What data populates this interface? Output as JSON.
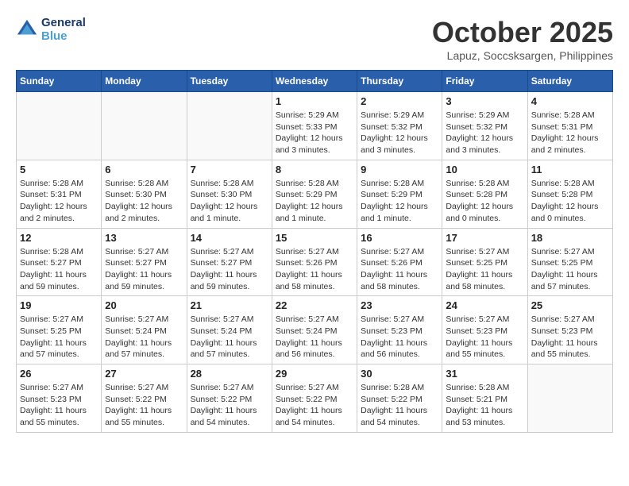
{
  "header": {
    "logo": {
      "line1": "General",
      "line2": "Blue"
    },
    "title": "October 2025",
    "location": "Lapuz, Soccsksargen, Philippines"
  },
  "days_of_week": [
    "Sunday",
    "Monday",
    "Tuesday",
    "Wednesday",
    "Thursday",
    "Friday",
    "Saturday"
  ],
  "weeks": [
    [
      {
        "day": "",
        "info": ""
      },
      {
        "day": "",
        "info": ""
      },
      {
        "day": "",
        "info": ""
      },
      {
        "day": "1",
        "info": "Sunrise: 5:29 AM\nSunset: 5:33 PM\nDaylight: 12 hours and 3 minutes."
      },
      {
        "day": "2",
        "info": "Sunrise: 5:29 AM\nSunset: 5:32 PM\nDaylight: 12 hours and 3 minutes."
      },
      {
        "day": "3",
        "info": "Sunrise: 5:29 AM\nSunset: 5:32 PM\nDaylight: 12 hours and 3 minutes."
      },
      {
        "day": "4",
        "info": "Sunrise: 5:28 AM\nSunset: 5:31 PM\nDaylight: 12 hours and 2 minutes."
      }
    ],
    [
      {
        "day": "5",
        "info": "Sunrise: 5:28 AM\nSunset: 5:31 PM\nDaylight: 12 hours and 2 minutes."
      },
      {
        "day": "6",
        "info": "Sunrise: 5:28 AM\nSunset: 5:30 PM\nDaylight: 12 hours and 2 minutes."
      },
      {
        "day": "7",
        "info": "Sunrise: 5:28 AM\nSunset: 5:30 PM\nDaylight: 12 hours and 1 minute."
      },
      {
        "day": "8",
        "info": "Sunrise: 5:28 AM\nSunset: 5:29 PM\nDaylight: 12 hours and 1 minute."
      },
      {
        "day": "9",
        "info": "Sunrise: 5:28 AM\nSunset: 5:29 PM\nDaylight: 12 hours and 1 minute."
      },
      {
        "day": "10",
        "info": "Sunrise: 5:28 AM\nSunset: 5:28 PM\nDaylight: 12 hours and 0 minutes."
      },
      {
        "day": "11",
        "info": "Sunrise: 5:28 AM\nSunset: 5:28 PM\nDaylight: 12 hours and 0 minutes."
      }
    ],
    [
      {
        "day": "12",
        "info": "Sunrise: 5:28 AM\nSunset: 5:27 PM\nDaylight: 11 hours and 59 minutes."
      },
      {
        "day": "13",
        "info": "Sunrise: 5:27 AM\nSunset: 5:27 PM\nDaylight: 11 hours and 59 minutes."
      },
      {
        "day": "14",
        "info": "Sunrise: 5:27 AM\nSunset: 5:27 PM\nDaylight: 11 hours and 59 minutes."
      },
      {
        "day": "15",
        "info": "Sunrise: 5:27 AM\nSunset: 5:26 PM\nDaylight: 11 hours and 58 minutes."
      },
      {
        "day": "16",
        "info": "Sunrise: 5:27 AM\nSunset: 5:26 PM\nDaylight: 11 hours and 58 minutes."
      },
      {
        "day": "17",
        "info": "Sunrise: 5:27 AM\nSunset: 5:25 PM\nDaylight: 11 hours and 58 minutes."
      },
      {
        "day": "18",
        "info": "Sunrise: 5:27 AM\nSunset: 5:25 PM\nDaylight: 11 hours and 57 minutes."
      }
    ],
    [
      {
        "day": "19",
        "info": "Sunrise: 5:27 AM\nSunset: 5:25 PM\nDaylight: 11 hours and 57 minutes."
      },
      {
        "day": "20",
        "info": "Sunrise: 5:27 AM\nSunset: 5:24 PM\nDaylight: 11 hours and 57 minutes."
      },
      {
        "day": "21",
        "info": "Sunrise: 5:27 AM\nSunset: 5:24 PM\nDaylight: 11 hours and 57 minutes."
      },
      {
        "day": "22",
        "info": "Sunrise: 5:27 AM\nSunset: 5:24 PM\nDaylight: 11 hours and 56 minutes."
      },
      {
        "day": "23",
        "info": "Sunrise: 5:27 AM\nSunset: 5:23 PM\nDaylight: 11 hours and 56 minutes."
      },
      {
        "day": "24",
        "info": "Sunrise: 5:27 AM\nSunset: 5:23 PM\nDaylight: 11 hours and 55 minutes."
      },
      {
        "day": "25",
        "info": "Sunrise: 5:27 AM\nSunset: 5:23 PM\nDaylight: 11 hours and 55 minutes."
      }
    ],
    [
      {
        "day": "26",
        "info": "Sunrise: 5:27 AM\nSunset: 5:23 PM\nDaylight: 11 hours and 55 minutes."
      },
      {
        "day": "27",
        "info": "Sunrise: 5:27 AM\nSunset: 5:22 PM\nDaylight: 11 hours and 55 minutes."
      },
      {
        "day": "28",
        "info": "Sunrise: 5:27 AM\nSunset: 5:22 PM\nDaylight: 11 hours and 54 minutes."
      },
      {
        "day": "29",
        "info": "Sunrise: 5:27 AM\nSunset: 5:22 PM\nDaylight: 11 hours and 54 minutes."
      },
      {
        "day": "30",
        "info": "Sunrise: 5:28 AM\nSunset: 5:22 PM\nDaylight: 11 hours and 54 minutes."
      },
      {
        "day": "31",
        "info": "Sunrise: 5:28 AM\nSunset: 5:21 PM\nDaylight: 11 hours and 53 minutes."
      },
      {
        "day": "",
        "info": ""
      }
    ]
  ]
}
